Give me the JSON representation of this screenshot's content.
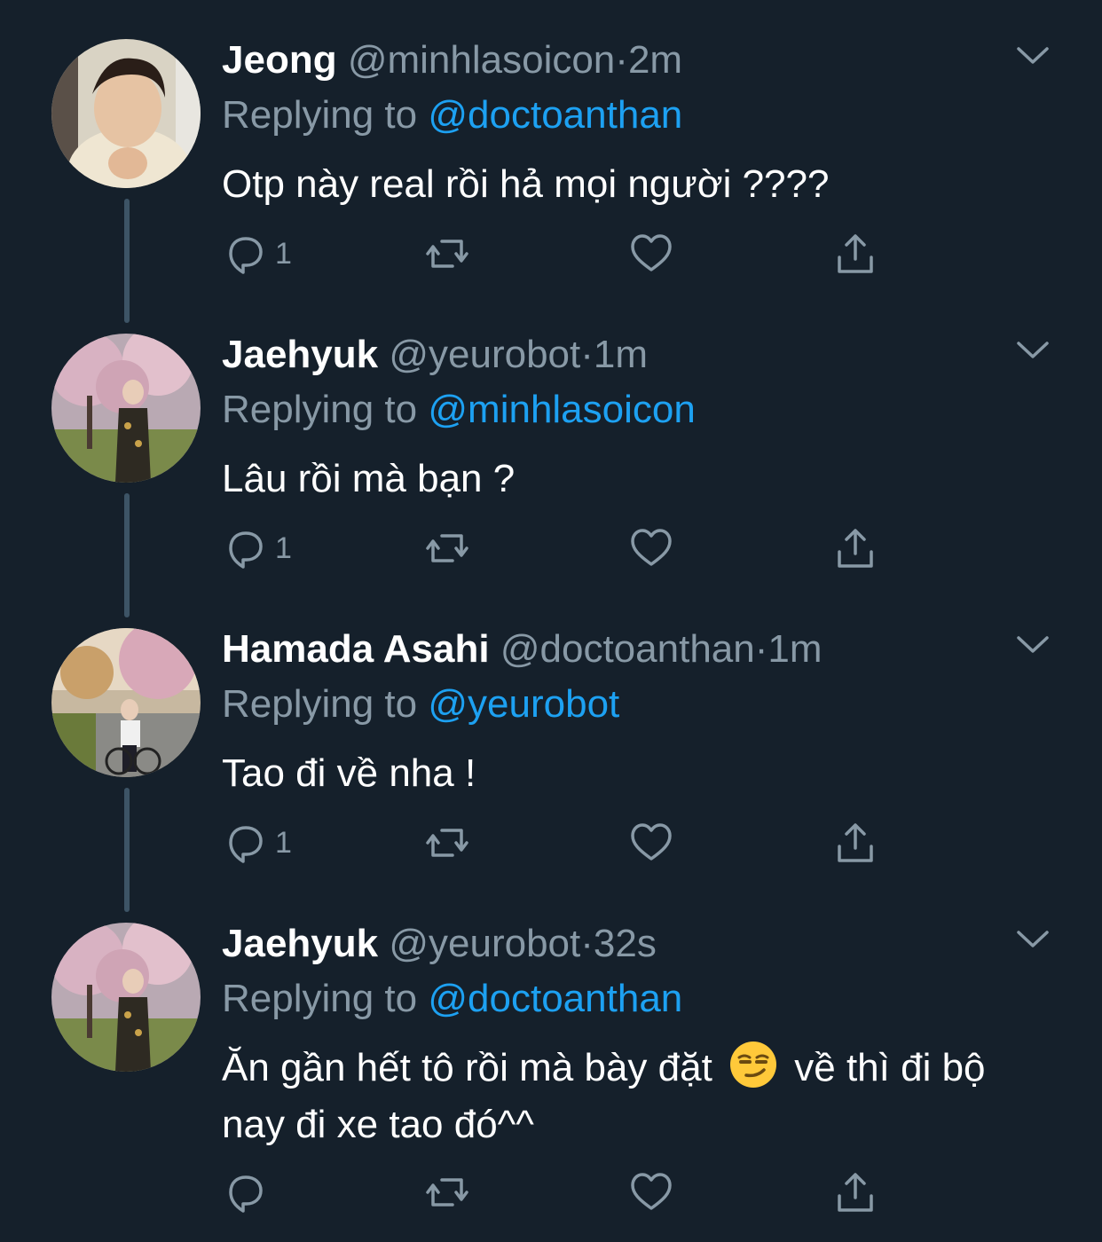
{
  "colors": {
    "background": "#15202b",
    "name": "#ffffff",
    "muted": "#8899a6",
    "mention": "#1da1f2",
    "thread_line": "#3d5466"
  },
  "tweets": [
    {
      "name": "Jeong",
      "handle": "@minhlasoicon",
      "separator": "·",
      "time": "2m",
      "replying_prefix": "Replying to",
      "replying_to": "@doctoanthan",
      "text": "Otp này real rồi hả mọi người ????",
      "reply_count": "1",
      "avatar": "young man in cream sweater, indoor"
    },
    {
      "name": "Jaehyuk",
      "handle": "@yeurobot",
      "separator": "·",
      "time": "1m",
      "replying_prefix": "Replying to",
      "replying_to": "@minhlasoicon",
      "text": "Lâu rồi mà bạn ?",
      "reply_count": "1",
      "avatar": "person under cherry blossom tree"
    },
    {
      "name": "Hamada Asahi",
      "handle": "@doctoanthan",
      "separator": "·",
      "time": "1m",
      "replying_prefix": "Replying to",
      "replying_to": "@yeurobot",
      "text": "Tao đi về nha !",
      "reply_count": "1",
      "avatar": "person on bicycle under cherry blossoms"
    },
    {
      "name": "Jaehyuk",
      "handle": "@yeurobot",
      "separator": "·",
      "time": "32s",
      "replying_prefix": "Replying to",
      "replying_to": "@doctoanthan",
      "text_part1": "Ăn gần hết tô rồi mà bày đặt",
      "text_emoji": "smirking-face-emoji",
      "text_part2": "về thì đi bộ nay đi xe tao đó^^",
      "reply_count": "",
      "avatar": "person under cherry blossom tree"
    }
  ]
}
